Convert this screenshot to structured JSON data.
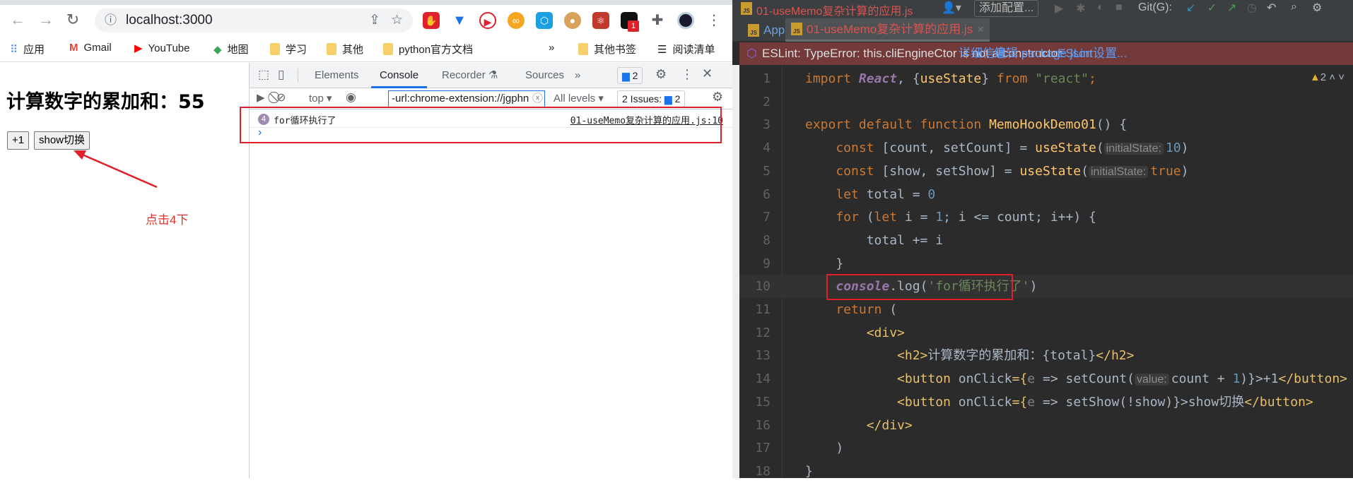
{
  "browser": {
    "url": "localhost:3000",
    "extension_badge": "1",
    "bookmarks": [
      "应用",
      "Gmail",
      "YouTube",
      "地图",
      "学习",
      "其他",
      "python官方文档"
    ],
    "bookmarks_overflow": "»",
    "other_bookmarks": "其他书签",
    "reading_list": "阅读清单"
  },
  "page": {
    "heading": "计算数字的累加和：55",
    "buttons": [
      "+1",
      "show切换"
    ],
    "annotation": "点击4下"
  },
  "devtools": {
    "tabs": [
      "Elements",
      "Console",
      "Recorder ⚗",
      "Sources"
    ],
    "active_tab": "Console",
    "more_tabs": "»",
    "message_badge": "2",
    "context": "top",
    "filter_value": "-url:chrome-extension://jgphn",
    "levels": "All levels",
    "issues_label": "2 Issues:",
    "issues_count": "2",
    "log": {
      "count": "4",
      "message": "for循环执行了",
      "source": "01-useMemo复杂计算的应用.js:10"
    },
    "prompt": "›"
  },
  "ide": {
    "title_file": "01-useMemo复杂计算的应用.js",
    "add_config": "添加配置...",
    "git_label": "Git(G):",
    "tabs": [
      "App.js",
      "01-useMemo复杂计算的应用.js"
    ],
    "error": {
      "message": "ESLint: TypeError: this.cliEngineCtor is not a constructor",
      "links": [
        "详细信息",
        "编辑 package.json",
        "ESLint设置..."
      ]
    },
    "warnings": "2",
    "accent_colors": {
      "keyword": "#cc7832",
      "function": "#ffc66d",
      "string": "#6a8759",
      "number": "#6897bb",
      "error_bar": "#743a3a"
    },
    "code": [
      [
        [
          "import ",
          "kw"
        ],
        [
          "React",
          "pur"
        ],
        [
          ", {",
          "df"
        ],
        [
          "useState",
          "fn"
        ],
        [
          "} ",
          "df"
        ],
        [
          "from ",
          "kw"
        ],
        [
          "\"react\"",
          "str"
        ],
        [
          ";",
          "kw"
        ]
      ],
      [],
      [
        [
          "export default function ",
          "kw"
        ],
        [
          "MemoHookDemo01",
          "fn"
        ],
        [
          "() {",
          "df"
        ]
      ],
      [
        [
          "    const ",
          "kw"
        ],
        [
          "[count, setCount] = ",
          "df"
        ],
        [
          "useState",
          "fn"
        ],
        [
          "(",
          "df"
        ],
        [
          "initialState:",
          "hint"
        ],
        [
          "10",
          "num"
        ],
        [
          ")",
          "df"
        ]
      ],
      [
        [
          "    const ",
          "kw"
        ],
        [
          "[show, setShow] = ",
          "df"
        ],
        [
          "useState",
          "fn"
        ],
        [
          "(",
          "df"
        ],
        [
          "initialState:",
          "hint"
        ],
        [
          "true",
          "kw"
        ],
        [
          ")",
          "df"
        ]
      ],
      [
        [
          "    let ",
          "kw"
        ],
        [
          "total = ",
          "df"
        ],
        [
          "0",
          "num"
        ]
      ],
      [
        [
          "    for ",
          "kw"
        ],
        [
          "(",
          "df"
        ],
        [
          "let ",
          "kw"
        ],
        [
          "i = ",
          "df"
        ],
        [
          "1",
          "num"
        ],
        [
          "; i <= count; i++) {",
          "df"
        ]
      ],
      [
        [
          "        total += i",
          "df"
        ]
      ],
      [
        [
          "    }",
          "df"
        ]
      ],
      [
        [
          "    ",
          "df"
        ],
        [
          "console",
          "pur"
        ],
        [
          ".log(",
          "df"
        ],
        [
          "'for循环执行了'",
          "str"
        ],
        [
          ")",
          "df"
        ]
      ],
      [
        [
          "    return ",
          "kw"
        ],
        [
          "(",
          "df"
        ]
      ],
      [
        [
          "        ",
          "df"
        ],
        [
          "<div>",
          "tag"
        ]
      ],
      [
        [
          "            ",
          "df"
        ],
        [
          "<h2>",
          "tag"
        ],
        [
          "计算数字的累加和：{total}",
          "df"
        ],
        [
          "</h2>",
          "tag"
        ]
      ],
      [
        [
          "            ",
          "df"
        ],
        [
          "<button ",
          "tag"
        ],
        [
          "onClick",
          "df"
        ],
        [
          "={",
          "tag"
        ],
        [
          "e",
          "hint2"
        ],
        [
          " => setCount(",
          "df"
        ],
        [
          "value:",
          "hint"
        ],
        [
          "count + ",
          "df"
        ],
        [
          "1",
          "num"
        ],
        [
          ")}",
          "df"
        ],
        [
          ">+1",
          "df"
        ],
        [
          "</button>",
          "tag"
        ]
      ],
      [
        [
          "            ",
          "df"
        ],
        [
          "<button ",
          "tag"
        ],
        [
          "onClick",
          "df"
        ],
        [
          "={",
          "tag"
        ],
        [
          "e",
          "hint2"
        ],
        [
          " => setShow(!show)}",
          "df"
        ],
        [
          ">show切换",
          "df"
        ],
        [
          "</button>",
          "tag"
        ]
      ],
      [
        [
          "        ",
          "df"
        ],
        [
          "</div>",
          "tag"
        ]
      ],
      [
        [
          "    )",
          "df"
        ]
      ],
      [
        [
          "}",
          "df"
        ]
      ]
    ]
  }
}
